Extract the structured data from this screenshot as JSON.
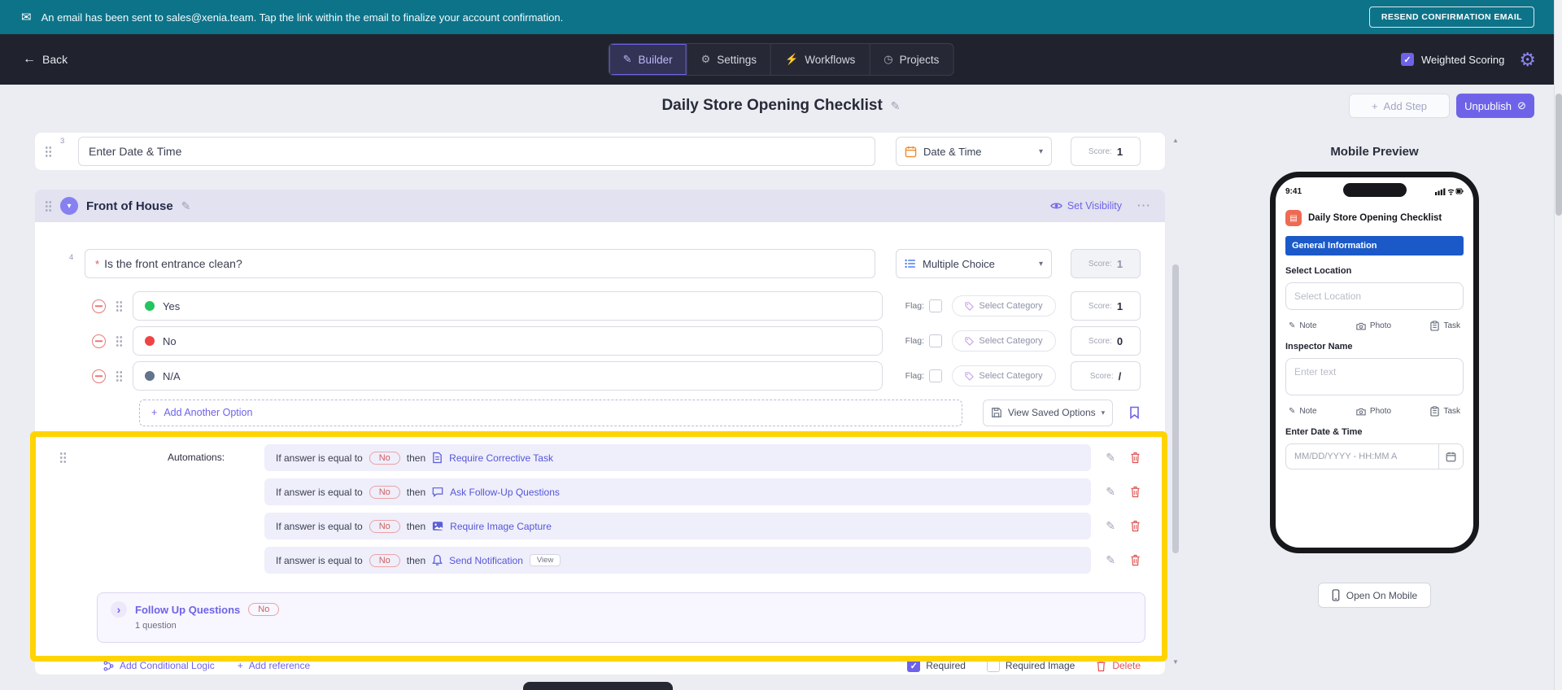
{
  "icons": {
    "mail": "✉",
    "back_arrow": "←",
    "builder_tab": "✎",
    "settings_tab": "⚙",
    "workflows_tab": "⚡",
    "projects_tab": "◷",
    "check": "✓",
    "gear": "⚙",
    "edit": "✎",
    "plus": "+",
    "chevron_down": "▾",
    "more": "⋯",
    "unpublish": "⊘",
    "scroll_up": "▲",
    "scroll_down": "▼",
    "follow_chevron": "›",
    "note": "✎"
  },
  "colors": {
    "accent": "#6E63E8",
    "banner": "#0D7389",
    "header": "#20232E",
    "danger": "#E05252",
    "highlight": "#FFD400",
    "option_yes": "#22C55E",
    "option_no": "#EF4444",
    "option_na": "#64748B",
    "mobile_section": "#1B59C8"
  },
  "banner": {
    "message": "An email has been sent to sales@xenia.team. Tap the link within the email to finalize your account confirmation.",
    "resend_button": "RESEND CONFIRMATION EMAIL"
  },
  "header": {
    "back_label": "Back",
    "tabs": [
      {
        "label": "Builder"
      },
      {
        "label": "Settings"
      },
      {
        "label": "Workflows"
      },
      {
        "label": "Projects"
      }
    ],
    "weighted_scoring_label": "Weighted Scoring"
  },
  "toolbar": {
    "title": "Daily Store Opening Checklist",
    "add_step_label": "Add Step",
    "unpublish_label": "Unpublish"
  },
  "builder": {
    "score_label": "Score:",
    "flag_label": "Flag:",
    "date_step": {
      "number": "3",
      "label": "Enter Date & Time",
      "type_label": "Date & Time",
      "score_value": "1"
    },
    "section": {
      "title": "Front of House",
      "set_visibility_label": "Set Visibility"
    },
    "question": {
      "number": "4",
      "required_mark": "*",
      "text": "Is the front entrance clean?",
      "type_label": "Multiple Choice",
      "score_value": "1"
    },
    "options": [
      {
        "label": "Yes",
        "category_label": "Select Category",
        "score_value": "1"
      },
      {
        "label": "No",
        "category_label": "Select Category",
        "score_value": "0"
      },
      {
        "label": "N/A",
        "category_label": "Select Category",
        "score_value": "/"
      }
    ],
    "add_option_label": "Add Another Option",
    "view_saved_options_label": "View Saved Options",
    "automations": {
      "label": "Automations:",
      "rows": [
        {
          "condition": "If answer is equal to",
          "value": "No",
          "connector": "then",
          "action": "Require Corrective Task"
        },
        {
          "condition": "If answer is equal to",
          "value": "No",
          "connector": "then",
          "action": "Ask Follow-Up Questions"
        },
        {
          "condition": "If answer is equal to",
          "value": "No",
          "connector": "then",
          "action": "Require Image Capture"
        },
        {
          "condition": "If answer is equal to",
          "value": "No",
          "connector": "then",
          "action": "Send Notification",
          "view_chip": "View"
        }
      ]
    },
    "followup": {
      "title": "Follow Up Questions",
      "value": "No",
      "count": "1 question"
    },
    "footer": {
      "conditional_label": "Add Conditional Logic",
      "reference_label": "Add reference",
      "required_label": "Required",
      "required_image_label": "Required Image",
      "delete_label": "Delete"
    }
  },
  "preview": {
    "title": "Mobile Preview",
    "status_time": "9:41",
    "app_title": "Daily Store Opening Checklist",
    "section_label": "General Information",
    "field1": {
      "label": "Select Location",
      "placeholder": "Select Location"
    },
    "field2": {
      "label": "Inspector Name",
      "placeholder": "Enter text"
    },
    "field3": {
      "label": "Enter Date & Time",
      "placeholder": "MM/DD/YYYY - HH:MM A"
    },
    "actions": {
      "note": "Note",
      "photo": "Photo",
      "task": "Task"
    },
    "open_on_mobile_label": "Open On Mobile"
  }
}
